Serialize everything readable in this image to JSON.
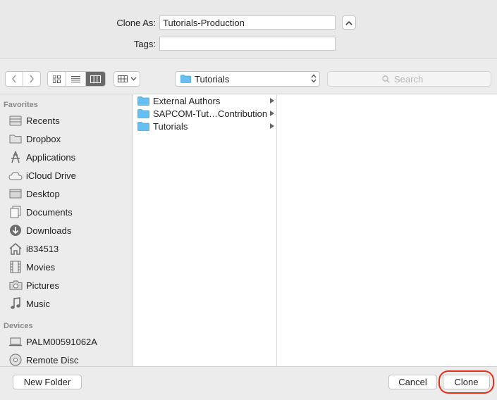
{
  "header": {
    "clone_as_label": "Clone As:",
    "clone_as_value": "Tutorials-Production",
    "tags_label": "Tags:",
    "tags_value": ""
  },
  "toolbar": {
    "location": "Tutorials",
    "search_placeholder": "Search",
    "active_view": "columns"
  },
  "sidebar": {
    "favorites_title": "Favorites",
    "favorites": [
      {
        "label": "Recents",
        "icon": "recents-icon"
      },
      {
        "label": "Dropbox",
        "icon": "folder-icon"
      },
      {
        "label": "Applications",
        "icon": "applications-icon"
      },
      {
        "label": "iCloud Drive",
        "icon": "cloud-icon"
      },
      {
        "label": "Desktop",
        "icon": "desktop-icon"
      },
      {
        "label": "Documents",
        "icon": "documents-icon"
      },
      {
        "label": "Downloads",
        "icon": "downloads-icon"
      },
      {
        "label": "i834513",
        "icon": "home-icon"
      },
      {
        "label": "Movies",
        "icon": "movies-icon"
      },
      {
        "label": "Pictures",
        "icon": "camera-icon"
      },
      {
        "label": "Music",
        "icon": "music-icon"
      }
    ],
    "devices_title": "Devices",
    "devices": [
      {
        "label": "PALM00591062A",
        "icon": "laptop-icon"
      },
      {
        "label": "Remote Disc",
        "icon": "disc-icon"
      }
    ]
  },
  "browser": {
    "column1": [
      {
        "name": "External Authors"
      },
      {
        "name": "SAPCOM-Tut…Contribution"
      },
      {
        "name": "Tutorials"
      }
    ]
  },
  "footer": {
    "new_folder_label": "New Folder",
    "cancel_label": "Cancel",
    "clone_label": "Clone"
  },
  "colors": {
    "folder": "#66bff2",
    "highlight": "#e0301e",
    "active_segment": "#6a6a6a"
  }
}
